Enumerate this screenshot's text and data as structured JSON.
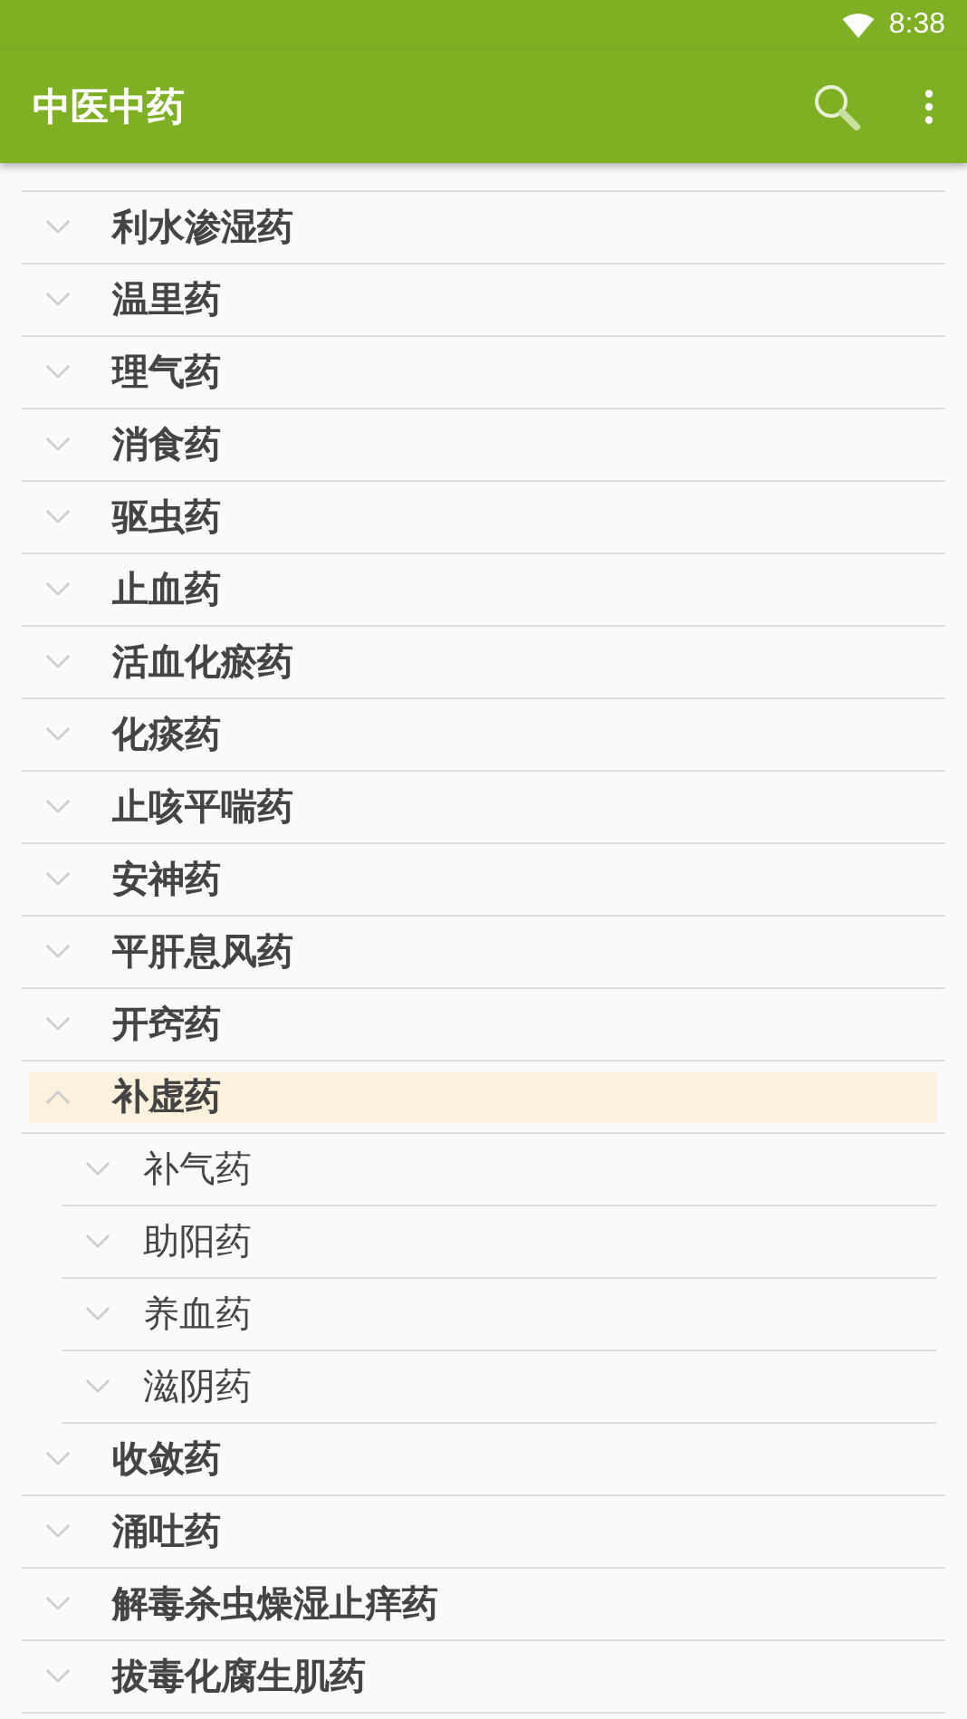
{
  "status_bar": {
    "time": "8:38"
  },
  "app_bar": {
    "title": "中医中药"
  },
  "categories": [
    {
      "label": "利水渗湿药",
      "expanded": false,
      "selected": false
    },
    {
      "label": "温里药",
      "expanded": false,
      "selected": false
    },
    {
      "label": "理气药",
      "expanded": false,
      "selected": false
    },
    {
      "label": "消食药",
      "expanded": false,
      "selected": false
    },
    {
      "label": "驱虫药",
      "expanded": false,
      "selected": false
    },
    {
      "label": "止血药",
      "expanded": false,
      "selected": false
    },
    {
      "label": "活血化瘀药",
      "expanded": false,
      "selected": false
    },
    {
      "label": "化痰药",
      "expanded": false,
      "selected": false
    },
    {
      "label": "止咳平喘药",
      "expanded": false,
      "selected": false
    },
    {
      "label": "安神药",
      "expanded": false,
      "selected": false
    },
    {
      "label": "平肝息风药",
      "expanded": false,
      "selected": false
    },
    {
      "label": "开窍药",
      "expanded": false,
      "selected": false
    },
    {
      "label": "补虚药",
      "expanded": true,
      "selected": true,
      "children": [
        {
          "label": "补气药",
          "expanded": false,
          "selected": false
        },
        {
          "label": "助阳药",
          "expanded": false,
          "selected": false
        },
        {
          "label": "养血药",
          "expanded": false,
          "selected": false
        },
        {
          "label": "滋阴药",
          "expanded": false,
          "selected": false
        }
      ]
    },
    {
      "label": "收敛药",
      "expanded": false,
      "selected": false
    },
    {
      "label": "涌吐药",
      "expanded": false,
      "selected": false
    },
    {
      "label": "解毒杀虫燥湿止痒药",
      "expanded": false,
      "selected": false
    },
    {
      "label": "拔毒化腐生肌药",
      "expanded": false,
      "selected": false
    }
  ]
}
